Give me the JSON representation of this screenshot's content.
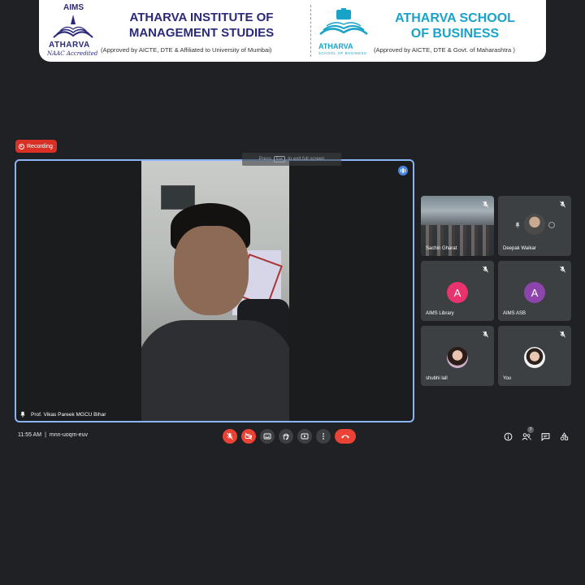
{
  "header": {
    "left": {
      "logo_top": "AIMS",
      "logo_name": "ATHARVA",
      "logo_accreditation": "NAAC Accredited",
      "title_line1": "ATHARVA INSTITUTE OF",
      "title_line2": "MANAGEMENT STUDIES",
      "subtitle": "(Approved by AICTE, DTE  & Affiliated to University of Mumbai)"
    },
    "right": {
      "logo_name": "ATHARVA",
      "logo_sub": "SCHOOL OF BUSINESS",
      "title_line1": "ATHARVA SCHOOL",
      "title_line2": "OF BUSINESS",
      "subtitle": "(Approved by AICTE, DTE & Govt. of Maharashtra )"
    },
    "colors": {
      "navy": "#2b2a7a",
      "cyan": "#1aa3c8"
    }
  },
  "recording": {
    "label": "Recording",
    "color": "#d93025"
  },
  "fullscreen_hint": {
    "prefix": "Press",
    "key": "Esc",
    "suffix": "to exit full screen"
  },
  "main_video": {
    "participant": "Prof. Vikas Pareek MGCU Bihar",
    "speaking_icon": "audio-level-icon",
    "border_color": "#8ab4f8"
  },
  "participants": [
    {
      "name": "Sachin Gharat",
      "type": "video",
      "icon": "mic-off-icon"
    },
    {
      "name": "Deepak Waikar",
      "type": "photo",
      "icon": "mic-off-icon"
    },
    {
      "name": "AIMS Library",
      "type": "initial",
      "initial": "A",
      "color": "#e8336f",
      "icon": "mic-off-icon"
    },
    {
      "name": "AIMS ASB",
      "type": "initial",
      "initial": "A",
      "color": "#8e44ad",
      "icon": "mic-off-icon"
    },
    {
      "name": "shubhi lall",
      "type": "photo",
      "icon": "mic-off-icon"
    },
    {
      "name": "You",
      "type": "photo",
      "icon": "mic-off-icon"
    }
  ],
  "bottom_bar": {
    "time": "11:55 AM",
    "separator": "|",
    "meeting_code": "mnn-uoqm-euv",
    "participant_count": "7"
  }
}
